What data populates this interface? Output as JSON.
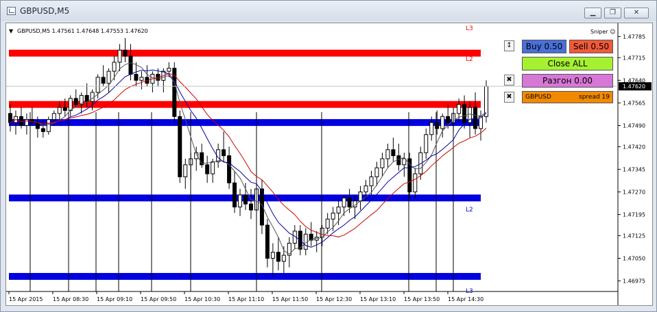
{
  "window": {
    "title": "GBPUSD,M5",
    "controls": [
      "minimize",
      "restore",
      "close"
    ]
  },
  "chart_header": {
    "symbol_info": "GBPUSD,M5  1.47561 1.47648 1.47553 1.47620",
    "sniper_label": "Sniper ☺"
  },
  "level_labels": {
    "l3_top": "L3",
    "l2_top": "L2",
    "l2_bottom": "L2",
    "l3_bottom": "L3"
  },
  "panel": {
    "buy_label": "Buy 0.50",
    "sell_label": "Sell 0.50",
    "close_all_label": "Close ALL",
    "razgon_label": "Разгон 0.00",
    "symbol_label": "GBPUSD",
    "spread_label": "spread 19",
    "toggle_icon": "↕",
    "close_icon_1": "✖",
    "close_icon_2": "✖"
  },
  "colors": {
    "buy": "#4a6fd8",
    "sell": "#f05a3a",
    "close_all": "#a6f032",
    "razgon": "#d777d6",
    "symbol_bar": "#f18a00",
    "red_level": "#ff0000",
    "blue_level": "#0000e0",
    "candle": "#000000",
    "ma_red": "#cc0000",
    "ma_blue": "#0000a0"
  },
  "chart_data": {
    "type": "candlestick",
    "symbol": "GBPUSD",
    "timeframe": "M5",
    "current_price": 1.4762,
    "ohlc_header": {
      "open": 1.47561,
      "high": 1.47648,
      "low": 1.47553,
      "close": 1.4762
    },
    "y_ticks": [
      "1.47785",
      "1.47715",
      "1.47640",
      "1.47565",
      "1.47490",
      "1.47420",
      "1.47345",
      "1.47270",
      "1.47195",
      "1.47125",
      "1.47050",
      "1.46975"
    ],
    "y_range": [
      1.4694,
      1.4782
    ],
    "x_ticks": [
      "15 Apr 2015",
      "15 Apr 08:30",
      "15 Apr 09:10",
      "15 Apr 09:50",
      "15 Apr 10:30",
      "15 Apr 11:10",
      "15 Apr 11:50",
      "15 Apr 12:30",
      "15 Apr 13:10",
      "15 Apr 13:50",
      "15 Apr 14:30"
    ],
    "levels": [
      {
        "label": "L2",
        "color": "red",
        "price": 1.4773
      },
      {
        "label": "",
        "color": "red",
        "price": 1.4756
      },
      {
        "label": "",
        "color": "blue",
        "price": 1.475
      },
      {
        "label": "L2",
        "color": "blue",
        "price": 1.4725
      },
      {
        "label": "L3",
        "color": "blue",
        "price": 1.4699
      }
    ],
    "candles": [
      [
        1.4753,
        1.4756,
        1.4747,
        1.475
      ],
      [
        1.475,
        1.4754,
        1.4746,
        1.4752
      ],
      [
        1.4752,
        1.4755,
        1.4748,
        1.4749
      ],
      [
        1.4749,
        1.4753,
        1.4746,
        1.4751
      ],
      [
        1.4751,
        1.4755,
        1.4749,
        1.475
      ],
      [
        1.475,
        1.4752,
        1.4745,
        1.4748
      ],
      [
        1.4748,
        1.4751,
        1.4745,
        1.4747
      ],
      [
        1.4747,
        1.4752,
        1.4746,
        1.4751
      ],
      [
        1.4751,
        1.4754,
        1.4749,
        1.4753
      ],
      [
        1.4753,
        1.4757,
        1.4751,
        1.4755
      ],
      [
        1.4755,
        1.4758,
        1.4752,
        1.4754
      ],
      [
        1.4754,
        1.4759,
        1.4752,
        1.4758
      ],
      [
        1.4758,
        1.4761,
        1.4755,
        1.4756
      ],
      [
        1.4756,
        1.476,
        1.4753,
        1.4759
      ],
      [
        1.4759,
        1.4763,
        1.4755,
        1.4757
      ],
      [
        1.4757,
        1.4761,
        1.4754,
        1.476
      ],
      [
        1.476,
        1.4766,
        1.4758,
        1.4765
      ],
      [
        1.4765,
        1.4769,
        1.4762,
        1.4763
      ],
      [
        1.4763,
        1.4768,
        1.476,
        1.4767
      ],
      [
        1.4767,
        1.4772,
        1.4764,
        1.477
      ],
      [
        1.477,
        1.4776,
        1.4767,
        1.4774
      ],
      [
        1.4774,
        1.4778,
        1.477,
        1.4772
      ],
      [
        1.4772,
        1.4776,
        1.4764,
        1.4766
      ],
      [
        1.4766,
        1.477,
        1.4762,
        1.4764
      ],
      [
        1.4764,
        1.4767,
        1.4761,
        1.4765
      ],
      [
        1.4765,
        1.4769,
        1.4762,
        1.4763
      ],
      [
        1.4763,
        1.4767,
        1.476,
        1.4766
      ],
      [
        1.4766,
        1.4768,
        1.4762,
        1.4764
      ],
      [
        1.4764,
        1.4768,
        1.476,
        1.4767
      ],
      [
        1.4767,
        1.477,
        1.4765,
        1.4768
      ],
      [
        1.4768,
        1.477,
        1.475,
        1.4752
      ],
      [
        1.4752,
        1.4754,
        1.473,
        1.4732
      ],
      [
        1.4732,
        1.4738,
        1.4728,
        1.4736
      ],
      [
        1.4736,
        1.474,
        1.4731,
        1.4738
      ],
      [
        1.4738,
        1.4742,
        1.4734,
        1.474
      ],
      [
        1.474,
        1.4743,
        1.4735,
        1.4736
      ],
      [
        1.4736,
        1.4739,
        1.473,
        1.4733
      ],
      [
        1.4733,
        1.4738,
        1.473,
        1.4737
      ],
      [
        1.4737,
        1.4743,
        1.4735,
        1.4741
      ],
      [
        1.4741,
        1.4747,
        1.4737,
        1.4739
      ],
      [
        1.4739,
        1.4742,
        1.4728,
        1.473
      ],
      [
        1.473,
        1.4734,
        1.472,
        1.4722
      ],
      [
        1.4722,
        1.4728,
        1.4719,
        1.4726
      ],
      [
        1.4726,
        1.473,
        1.4721,
        1.4723
      ],
      [
        1.4723,
        1.4728,
        1.4718,
        1.4721
      ],
      [
        1.4721,
        1.473,
        1.4716,
        1.4728
      ],
      [
        1.4728,
        1.4731,
        1.4713,
        1.4716
      ],
      [
        1.4716,
        1.4718,
        1.4702,
        1.4705
      ],
      [
        1.4705,
        1.471,
        1.4699,
        1.4707
      ],
      [
        1.4707,
        1.4712,
        1.4701,
        1.4704
      ],
      [
        1.4704,
        1.4709,
        1.47,
        1.4706
      ],
      [
        1.4706,
        1.4712,
        1.4702,
        1.471
      ],
      [
        1.471,
        1.4716,
        1.4708,
        1.4714
      ],
      [
        1.4714,
        1.4716,
        1.4706,
        1.4708
      ],
      [
        1.4708,
        1.4715,
        1.4706,
        1.4713
      ],
      [
        1.4713,
        1.4717,
        1.4709,
        1.4711
      ],
      [
        1.4711,
        1.4714,
        1.4707,
        1.4712
      ],
      [
        1.4712,
        1.4716,
        1.4709,
        1.4715
      ],
      [
        1.4715,
        1.472,
        1.4713,
        1.4718
      ],
      [
        1.4718,
        1.4722,
        1.4714,
        1.472
      ],
      [
        1.472,
        1.4724,
        1.4716,
        1.4722
      ],
      [
        1.4722,
        1.4726,
        1.4719,
        1.4725
      ],
      [
        1.4725,
        1.4728,
        1.472,
        1.4722
      ],
      [
        1.4722,
        1.4726,
        1.4718,
        1.4724
      ],
      [
        1.4724,
        1.4729,
        1.4721,
        1.4727
      ],
      [
        1.4727,
        1.4731,
        1.4724,
        1.4729
      ],
      [
        1.4729,
        1.4734,
        1.4726,
        1.4732
      ],
      [
        1.4732,
        1.4737,
        1.4729,
        1.4735
      ],
      [
        1.4735,
        1.474,
        1.4732,
        1.4738
      ],
      [
        1.4738,
        1.4743,
        1.4735,
        1.4741
      ],
      [
        1.4741,
        1.4745,
        1.4737,
        1.4739
      ],
      [
        1.4739,
        1.4743,
        1.4734,
        1.4736
      ],
      [
        1.4736,
        1.474,
        1.4732,
        1.4738
      ],
      [
        1.4738,
        1.474,
        1.4725,
        1.4727
      ],
      [
        1.4727,
        1.4735,
        1.4725,
        1.4733
      ],
      [
        1.4733,
        1.4742,
        1.4731,
        1.474
      ],
      [
        1.474,
        1.4748,
        1.4738,
        1.4746
      ],
      [
        1.4746,
        1.4752,
        1.4744,
        1.475
      ],
      [
        1.475,
        1.4754,
        1.4746,
        1.4748
      ],
      [
        1.4748,
        1.4753,
        1.4745,
        1.4752
      ],
      [
        1.4752,
        1.4756,
        1.4748,
        1.475
      ],
      [
        1.475,
        1.4755,
        1.4747,
        1.4753
      ],
      [
        1.4753,
        1.4758,
        1.475,
        1.4756
      ],
      [
        1.4756,
        1.4759,
        1.4748,
        1.475
      ],
      [
        1.475,
        1.4757,
        1.4745,
        1.4755
      ],
      [
        1.4755,
        1.476,
        1.4746,
        1.4748
      ],
      [
        1.4748,
        1.4754,
        1.4744,
        1.4752
      ],
      [
        1.4752,
        1.4764,
        1.475,
        1.4762
      ]
    ],
    "moving_averages": [
      {
        "color": "blue",
        "period_label": ""
      },
      {
        "color": "red",
        "period_label": ""
      },
      {
        "color": "black",
        "period_label": ""
      }
    ]
  }
}
